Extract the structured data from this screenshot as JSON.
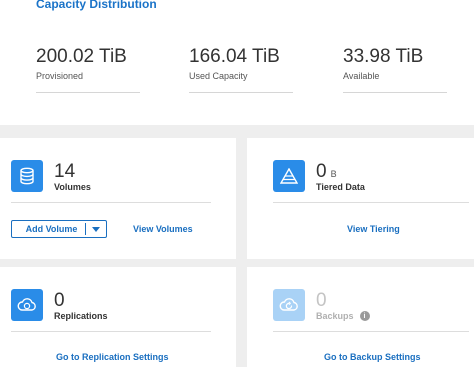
{
  "capacity": {
    "title": "Capacity Distribution",
    "stats": [
      {
        "value": "200.02 TiB",
        "label": "Provisioned"
      },
      {
        "value": "166.04 TiB",
        "label": "Used Capacity"
      },
      {
        "value": "33.98 TiB",
        "label": "Available"
      }
    ]
  },
  "volumes": {
    "count": "14",
    "label": "Volumes",
    "add_button": "Add Volume",
    "view_link": "View Volumes",
    "icon": "database-icon"
  },
  "tiering": {
    "count": "0",
    "unit": "B",
    "label": "Tiered Data",
    "view_link": "View Tiering",
    "icon": "pyramid-icon"
  },
  "replications": {
    "count": "0",
    "label": "Replications",
    "link": "Go to Replication Settings",
    "icon": "replication-cloud-icon"
  },
  "backups": {
    "count": "0",
    "label": "Backups",
    "info": "i",
    "link": "Go to Backup Settings",
    "icon": "backup-cloud-icon"
  },
  "colors": {
    "accent": "#1a73c8",
    "icon_bg": "#2a8ce8",
    "icon_bg_disabled": "#a9d2f6"
  }
}
